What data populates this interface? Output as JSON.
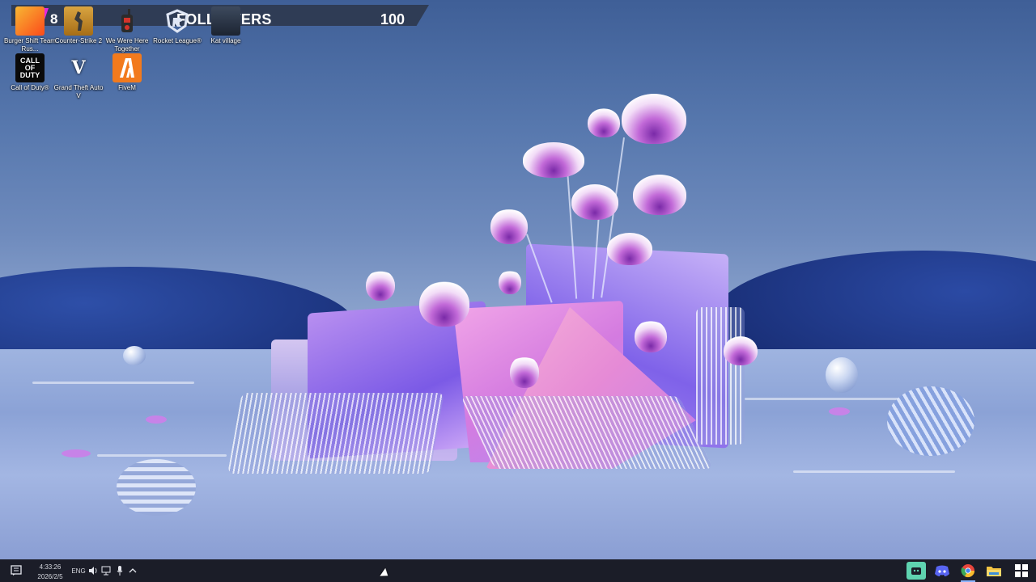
{
  "followers_widget": {
    "left_count": "8",
    "label": "FOLLOWERS",
    "value": "100",
    "accent_color": "#e626e0"
  },
  "desktop_icons": [
    {
      "label": "Burger Shift Team Rus...",
      "icon": "burger-shift-icon"
    },
    {
      "label": "Counter-Strike 2",
      "icon": "counter-strike-icon"
    },
    {
      "label": "We Were Here Together",
      "icon": "walkie-talkie-icon"
    },
    {
      "label": "Rocket League®",
      "icon": "rocket-league-icon"
    },
    {
      "label": "Kat village",
      "icon": "kat-village-icon"
    },
    {
      "label": "Call of Duty®",
      "icon": "call-of-duty-icon",
      "icon_text": "CALL OF DUTY"
    },
    {
      "label": "Grand Theft Auto V",
      "icon": "gta-v-icon",
      "icon_text": "V"
    },
    {
      "label": "FiveM",
      "icon": "fivem-icon"
    }
  ],
  "taskbar": {
    "time": "4:33:26",
    "date": "2026/2/5",
    "language": "ENG",
    "apps": [
      {
        "name": "streaming-app",
        "color": "#5fd3b0"
      },
      {
        "name": "discord",
        "color": "#5865f2"
      },
      {
        "name": "chrome",
        "color": "#e8453c"
      },
      {
        "name": "file-explorer",
        "color": "#f3c443"
      },
      {
        "name": "windows-start",
        "color": "#ffffff"
      }
    ]
  }
}
